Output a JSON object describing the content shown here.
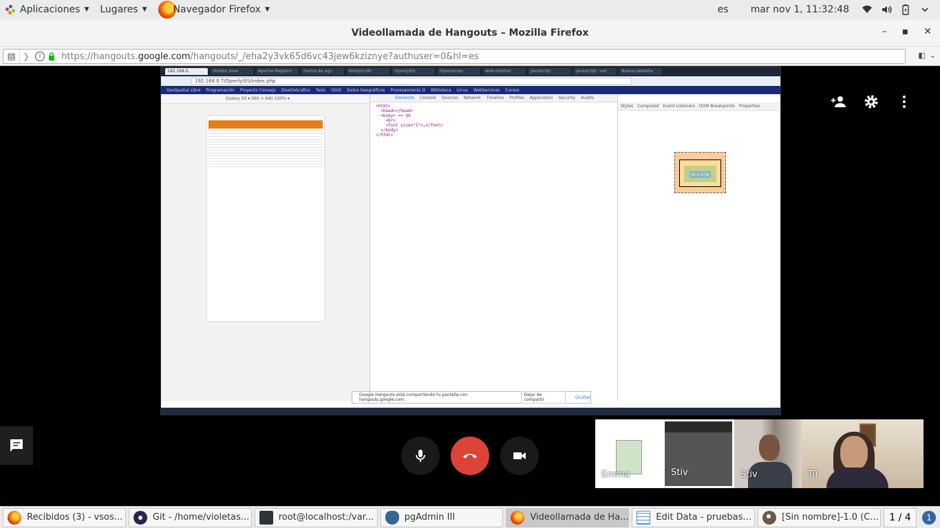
{
  "topbar": {
    "apps_label": "Aplicaciones",
    "places_label": "Lugares",
    "active_app_label": "Navegador Firefox",
    "lang": "es",
    "clock": "mar nov  1, 11:32:48"
  },
  "window": {
    "title": "Videollamada de Hangouts – Mozilla Firefox",
    "url_host_prefix": "https://hangouts.",
    "url_host": "google.com",
    "url_path": "/hangouts/_/eha2y3vk65d6vc43jew6kziznye?authuser=0&hl=es"
  },
  "shared_screen": {
    "tabs": [
      "192.168.0.",
      "Violeta Sosa",
      "Apache Registro",
      "marca de agu",
      "bootjs3-Htl",
      "OpenlySiS",
      "Hipocampo",
      "web-mostrar",
      "javascript",
      "javascript - ext",
      "Nueva pestaña"
    ],
    "omnibox": "192.168.0.7/OpenlySIS/index.php",
    "bookmarks": [
      "GeoSpatial Libre",
      "Programación",
      "Proyecto Consejo",
      "DiseñoGrafico",
      "Tesis",
      "OGIS",
      "Datos Geográficos",
      "Procesamiento D",
      "Biblioteca",
      "Linux",
      "WebServices",
      "Cursos"
    ],
    "device_toolbar": "Galaxy S5 ▾   360 × 640   100% ▾",
    "devtools_tabs": [
      "Elements",
      "Console",
      "Sources",
      "Network",
      "Timeline",
      "Profiles",
      "Application",
      "Security",
      "Audits"
    ],
    "dom_tree": "<html>\n  <head></head>\n  <body> == $0\n    <br>\n    <font size=\"1\">…</font>\n  </body>\n</html>",
    "styles_tabs": [
      "Styles",
      "Computed",
      "Event Listeners",
      "DOM Breakpoints",
      "Properties"
    ],
    "box_content": "95 × 1726",
    "share_banner_text": "Google Hangouts está compartiendo tu pantalla con hangouts.google.com.",
    "share_stop_label": "Dejar de compartir",
    "share_hide_label": "Ocultar"
  },
  "participants": [
    {
      "name": "Emma"
    },
    {
      "name": "Stiv"
    },
    {
      "name": "Stiv"
    },
    {
      "name": "Tú"
    }
  ],
  "taskbar": {
    "items": [
      {
        "label": "Recibidos (3) - vsos...",
        "icon": "firefox-icon"
      },
      {
        "label": "Git - /home/violetas...",
        "icon": "eclipse-icon"
      },
      {
        "label": "root@localhost:/var...",
        "icon": "terminal-icon"
      },
      {
        "label": "pgAdmin III",
        "icon": "pgadmin-icon"
      },
      {
        "label": "Videollamada de Ha...",
        "icon": "firefox-icon",
        "active": true
      },
      {
        "label": "Edit Data - pruebas...",
        "icon": "table-icon"
      },
      {
        "label": "[Sin nombre]-1.0 (C...",
        "icon": "gimp-icon"
      }
    ],
    "workspace": "1 / 4",
    "notifications": "1"
  },
  "colors": {
    "hangup": "#db4437",
    "stage_bg": "#000000",
    "gnome_bar": "#ebebeb"
  }
}
